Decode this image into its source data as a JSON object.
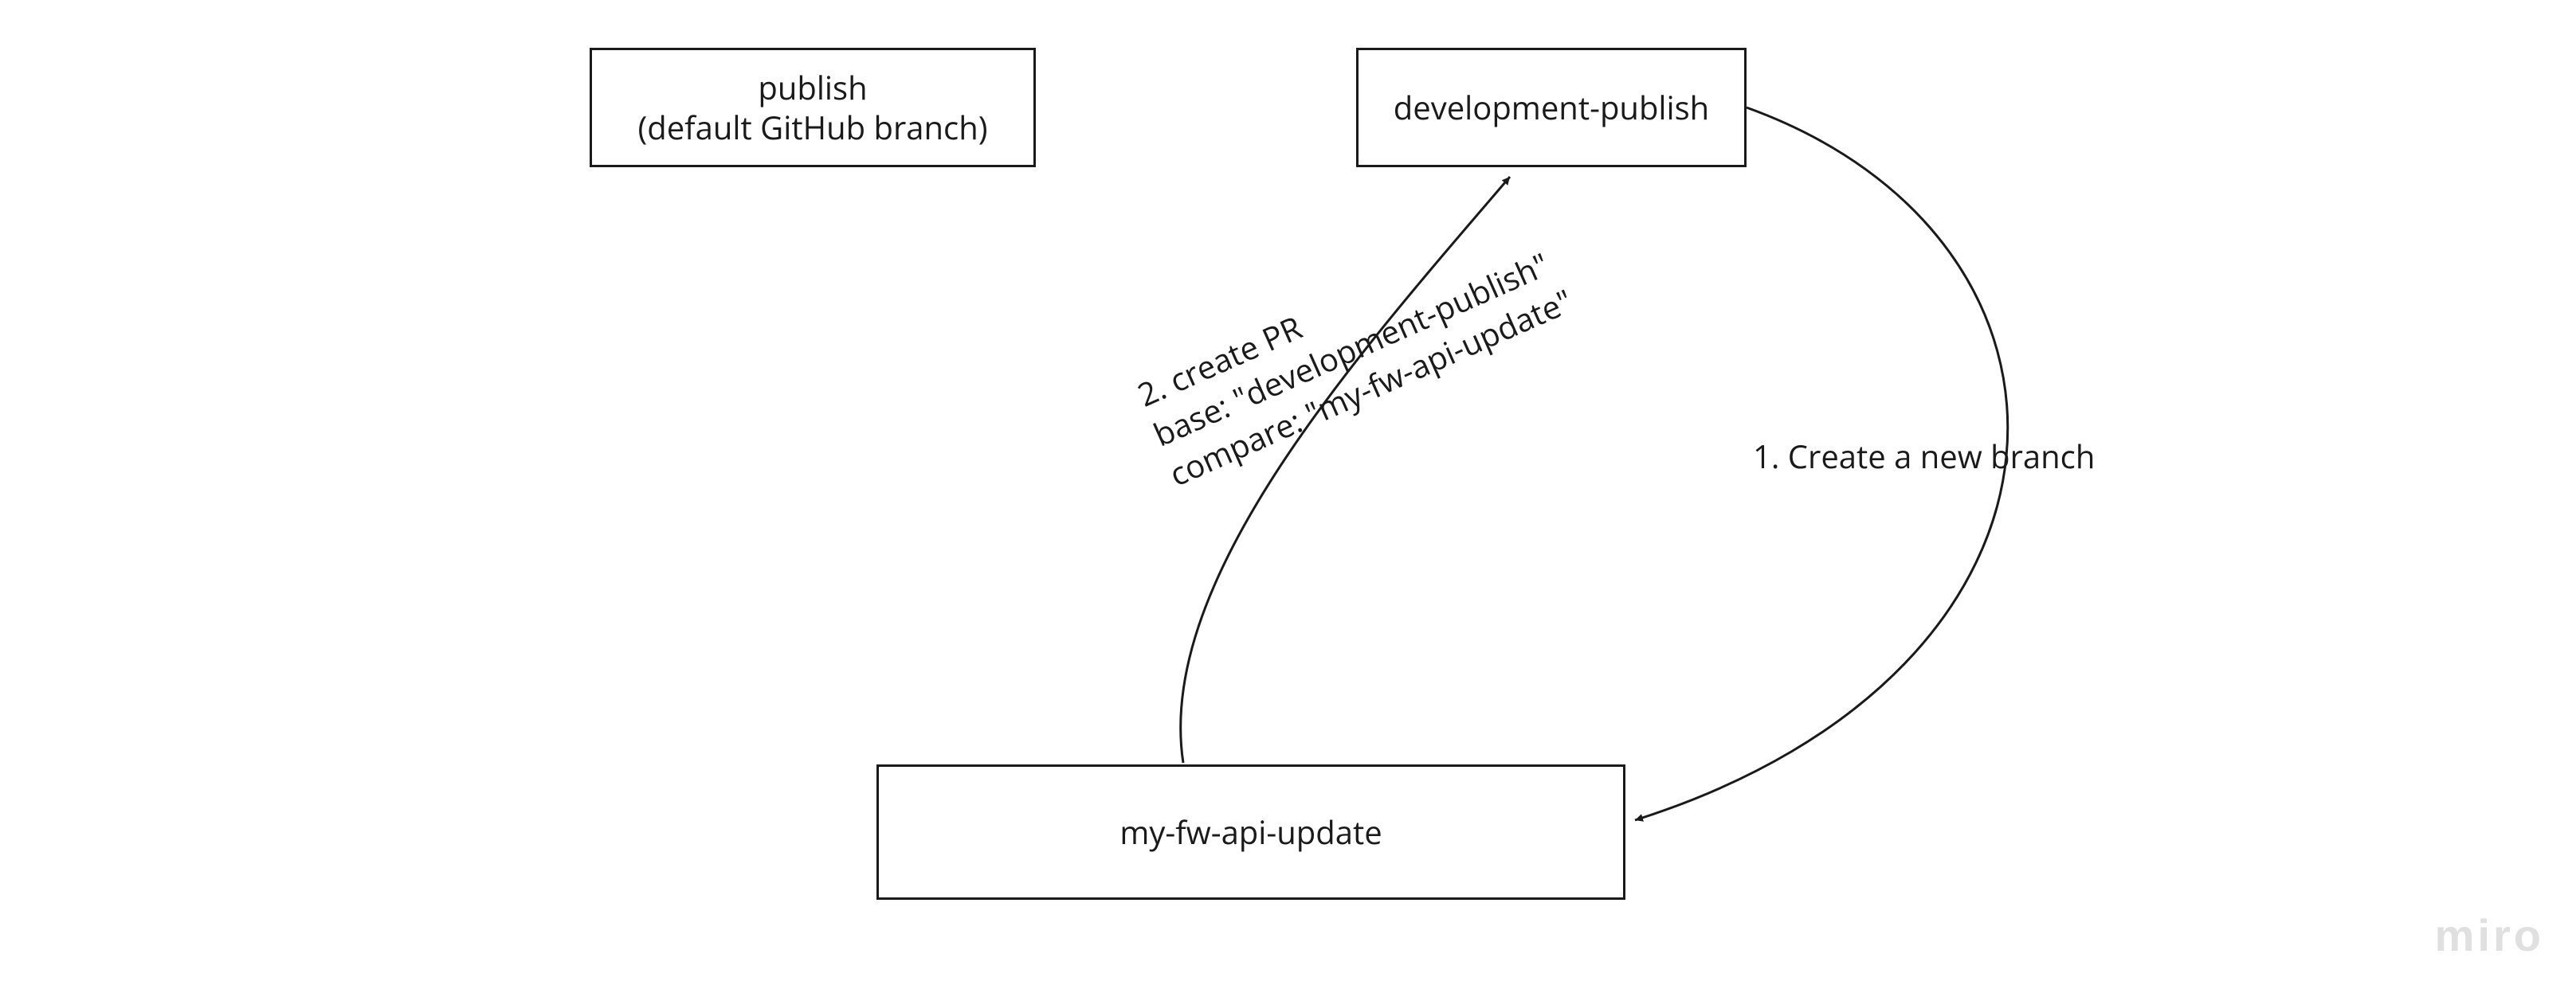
{
  "nodes": {
    "publish": {
      "line1": "publish",
      "line2": "(default GitHub branch)"
    },
    "development_publish": "development-publish",
    "my_fw_api_update": "my-fw-api-update"
  },
  "edges": {
    "create_branch": {
      "label": "1. Create a new branch"
    },
    "create_pr": {
      "line1": "2. create PR",
      "line2": "base: \"development-publish\"",
      "line3": "compare: \"my-fw-api-update\""
    }
  },
  "watermark": "miro"
}
